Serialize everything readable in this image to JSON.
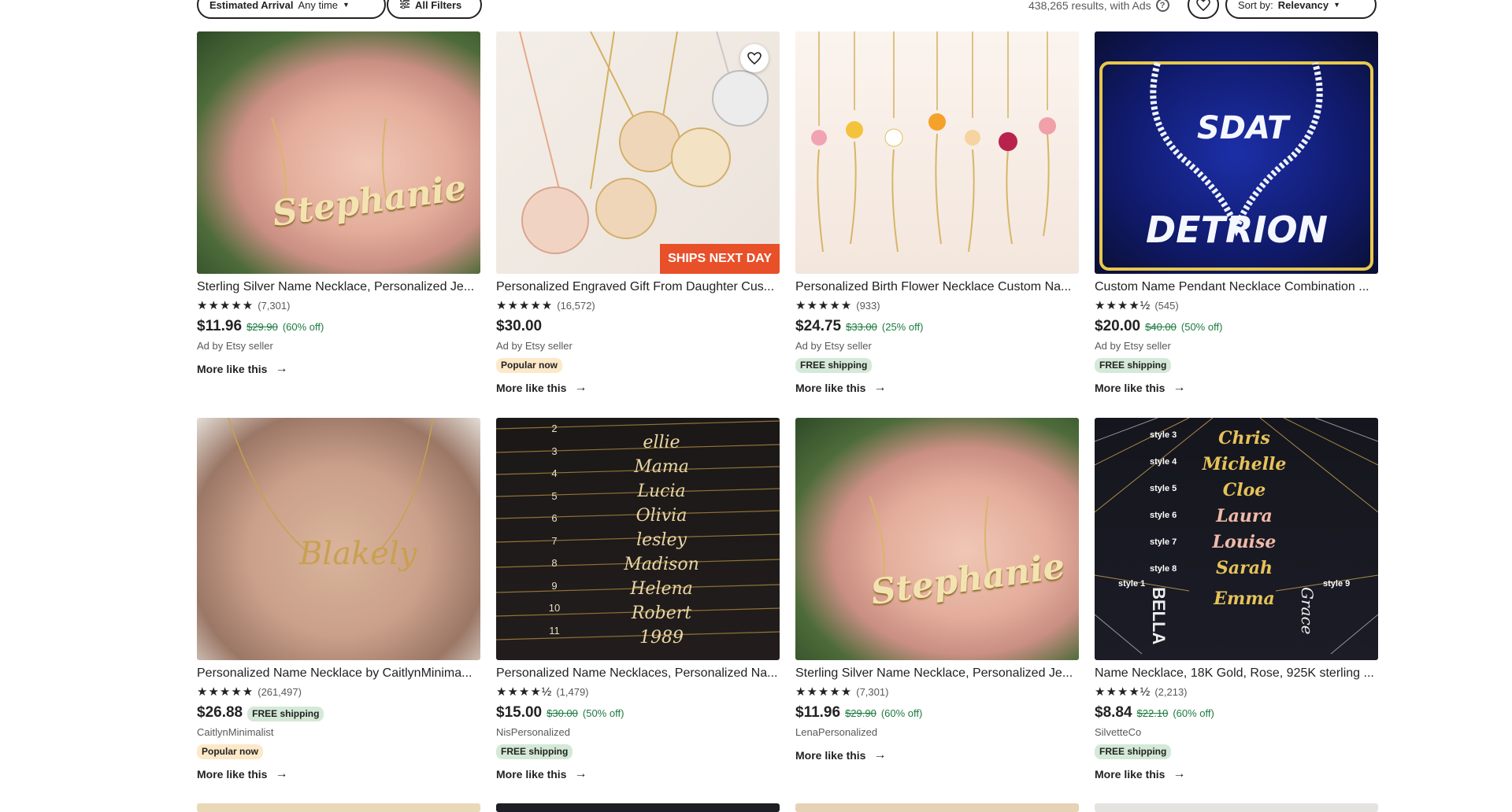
{
  "filters": {
    "arrival_label": "Estimated Arrival",
    "arrival_value": "Any time",
    "all_filters": "All Filters",
    "results_text": "438,265 results, with Ads",
    "sort_label": "Sort by:",
    "sort_value": "Relevancy"
  },
  "common": {
    "more_like_this": "More like this",
    "ad_by": "Ad by Etsy seller",
    "free_shipping": "FREE shipping",
    "popular_now": "Popular now"
  },
  "listings": [
    {
      "title": "Sterling Silver Name Necklace, Personalized Je...",
      "stars": "★★★★★",
      "reviews": "(7,301)",
      "price": "$11.96",
      "orig": "$29.90",
      "disc": "(60% off)",
      "seller": "Ad by Etsy seller",
      "image_text": "Stephanie"
    },
    {
      "title": "Personalized Engraved Gift From Daughter Cus...",
      "stars": "★★★★★",
      "reviews": "(16,572)",
      "price": "$30.00",
      "seller": "Ad by Etsy seller",
      "badge": "Popular now",
      "banner": "SHIPS NEXT DAY"
    },
    {
      "title": "Personalized Birth Flower Necklace Custom Na...",
      "stars": "★★★★★",
      "reviews": "(933)",
      "price": "$24.75",
      "orig": "$33.00",
      "disc": "(25% off)",
      "seller": "Ad by Etsy seller",
      "badge": "FREE shipping"
    },
    {
      "title": "Custom Name Pendant Necklace Combination ...",
      "stars": "★★★★½",
      "reviews": "(545)",
      "price": "$20.00",
      "orig": "$40.00",
      "disc": "(50% off)",
      "seller": "Ad by Etsy seller",
      "badge": "FREE shipping",
      "image_text_1": "SDAT",
      "image_text_2": "DETRION"
    },
    {
      "title": "Personalized Name Necklace by CaitlynMinima...",
      "stars": "★★★★★",
      "reviews": "(261,497)",
      "price": "$26.88",
      "seller": "CaitlynMinimalist",
      "inline_badge": "FREE shipping",
      "badge": "Popular now",
      "image_text": "Blakely"
    },
    {
      "title": "Personalized Name Necklaces, Personalized Na...",
      "stars": "★★★★½",
      "reviews": "(1,479)",
      "price": "$15.00",
      "orig": "$30.00",
      "disc": "(50% off)",
      "seller": "NisPersonalized",
      "badge": "FREE shipping",
      "image_names": [
        "ellie",
        "Mama",
        "Lucia",
        "Olivia",
        "lesley",
        "Madison",
        "Helena",
        "Robert",
        "1989"
      ],
      "image_numbers": [
        "2",
        "3",
        "4",
        "5",
        "6",
        "7",
        "8",
        "9",
        "10",
        "11"
      ]
    },
    {
      "title": "Sterling Silver Name Necklace, Personalized Je...",
      "stars": "★★★★★",
      "reviews": "(7,301)",
      "price": "$11.96",
      "orig": "$29.90",
      "disc": "(60% off)",
      "seller": "LenaPersonalized",
      "image_text": "Stephanie"
    },
    {
      "title": "Name Necklace, 18K Gold, Rose, 925K sterling ...",
      "stars": "★★★★½",
      "reviews": "(2,213)",
      "price": "$8.84",
      "orig": "$22.10",
      "disc": "(60% off)",
      "seller": "SilvetteCo",
      "badge": "FREE shipping",
      "image_styles": [
        "style 3",
        "style 4",
        "style 5",
        "style 6",
        "style 7",
        "style 8",
        "style 1",
        "style 9"
      ],
      "image_names": [
        "Chris",
        "Michelle",
        "Cloe",
        "Laura",
        "Louise",
        "Sarah",
        "Emma",
        "BELLA",
        "Grace"
      ]
    }
  ]
}
